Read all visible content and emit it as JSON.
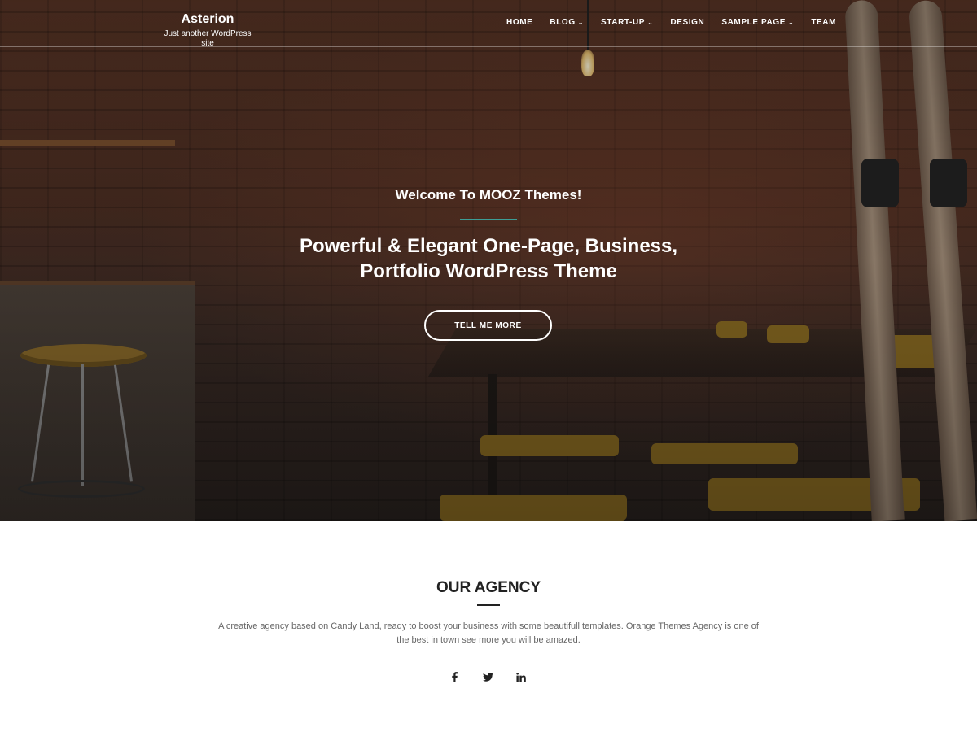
{
  "header": {
    "site_title": "Asterion",
    "tagline": "Just another WordPress site"
  },
  "nav": {
    "items": [
      {
        "label": "HOME",
        "has_dropdown": false
      },
      {
        "label": "BLOG",
        "has_dropdown": true
      },
      {
        "label": "START-UP",
        "has_dropdown": true
      },
      {
        "label": "DESIGN",
        "has_dropdown": false
      },
      {
        "label": "SAMPLE PAGE",
        "has_dropdown": true
      },
      {
        "label": "TEAM",
        "has_dropdown": false
      }
    ]
  },
  "hero": {
    "welcome": "Welcome To MOOZ Themes!",
    "headline_line1": "Powerful & Elegant One-Page, Business,",
    "headline_line2": "Portfolio WordPress Theme",
    "cta_label": "TELL ME MORE",
    "accent_color": "#3d9e96"
  },
  "agency": {
    "title": "OUR AGENCY",
    "description": "A creative agency based on Candy Land, ready to boost your business with some beautifull templates. Orange Themes Agency is one of the best in town see more you will be amazed.",
    "social": [
      {
        "icon": "facebook-icon",
        "glyph": "f"
      },
      {
        "icon": "twitter-icon",
        "glyph": "🐦"
      },
      {
        "icon": "linkedin-icon",
        "glyph": "in"
      }
    ]
  }
}
